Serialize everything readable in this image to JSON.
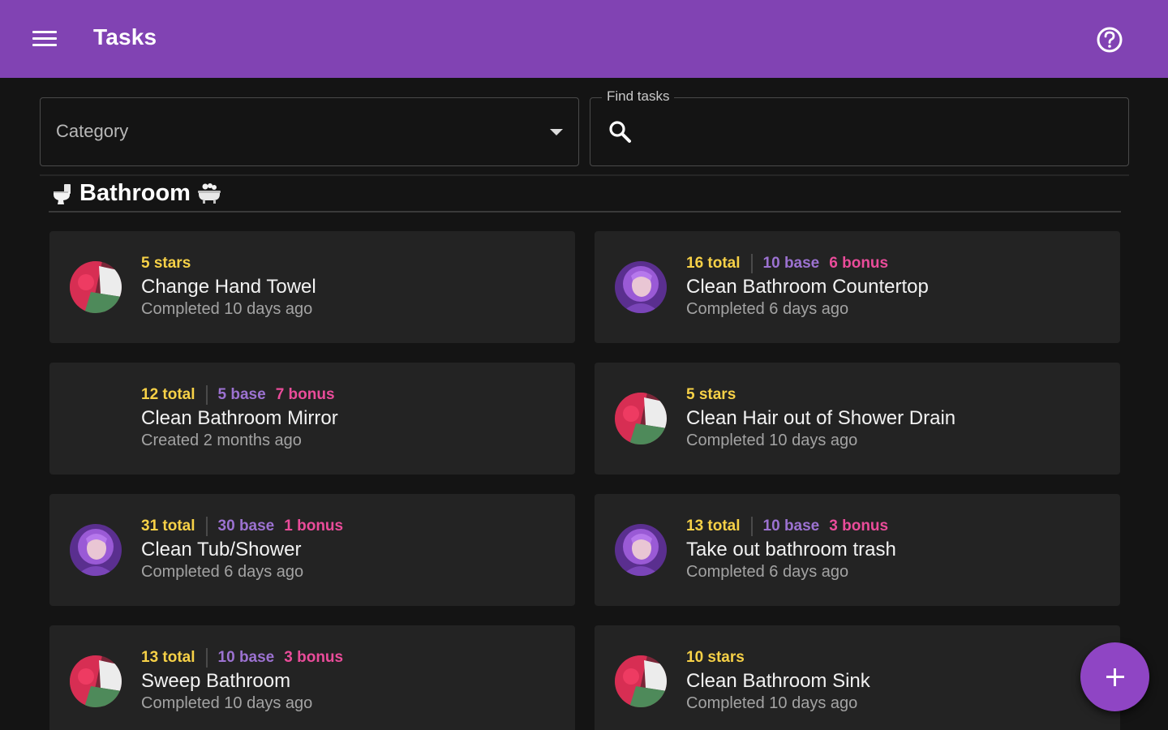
{
  "header": {
    "title": "Tasks",
    "menu_icon": "menu-icon",
    "help_icon": "help-circle-icon",
    "brand_color": "#8143b3"
  },
  "filters": {
    "category_placeholder": "Category",
    "search_label": "Find tasks",
    "search_value": ""
  },
  "section": {
    "title": "Bathroom",
    "leading_icon": "toilet-icon",
    "trailing_icon": "bathtub-icon"
  },
  "tasks": [
    {
      "title": "Change Hand Towel",
      "status": "Completed 10 days ago",
      "stars": "5 stars",
      "avatar": "avatar-red-hair"
    },
    {
      "title": "Clean Bathroom Countertop",
      "status": "Completed 6 days ago",
      "total": "16 total",
      "base": "10 base",
      "bonus": "6 bonus",
      "avatar": "avatar-purple-hair"
    },
    {
      "title": "Clean Bathroom Mirror",
      "status": "Created 2 months ago",
      "total": "12 total",
      "base": "5 base",
      "bonus": "7 bonus",
      "avatar": ""
    },
    {
      "title": "Clean Hair out of Shower Drain",
      "status": "Completed 10 days ago",
      "stars": "5 stars",
      "avatar": "avatar-red-hair"
    },
    {
      "title": "Clean Tub/Shower",
      "status": "Completed 6 days ago",
      "total": "31 total",
      "base": "30 base",
      "bonus": "1 bonus",
      "avatar": "avatar-purple-hair"
    },
    {
      "title": "Take out bathroom trash",
      "status": "Completed 6 days ago",
      "total": "13 total",
      "base": "10 base",
      "bonus": "3 bonus",
      "avatar": "avatar-purple-hair"
    },
    {
      "title": "Sweep Bathroom",
      "status": "Completed 10 days ago",
      "total": "13 total",
      "base": "10 base",
      "bonus": "3 bonus",
      "avatar": "avatar-red-hair"
    },
    {
      "title": "Clean Bathroom Sink",
      "status": "Completed 10 days ago",
      "stars": "10 stars",
      "avatar": "avatar-red-hair"
    }
  ],
  "fab": {
    "icon": "plus-icon"
  },
  "colors": {
    "background": "#141414",
    "card": "#232323",
    "total": "#f7d147",
    "base": "#9c72d1",
    "bonus": "#ea4c9a",
    "fab": "#8f45c4"
  }
}
